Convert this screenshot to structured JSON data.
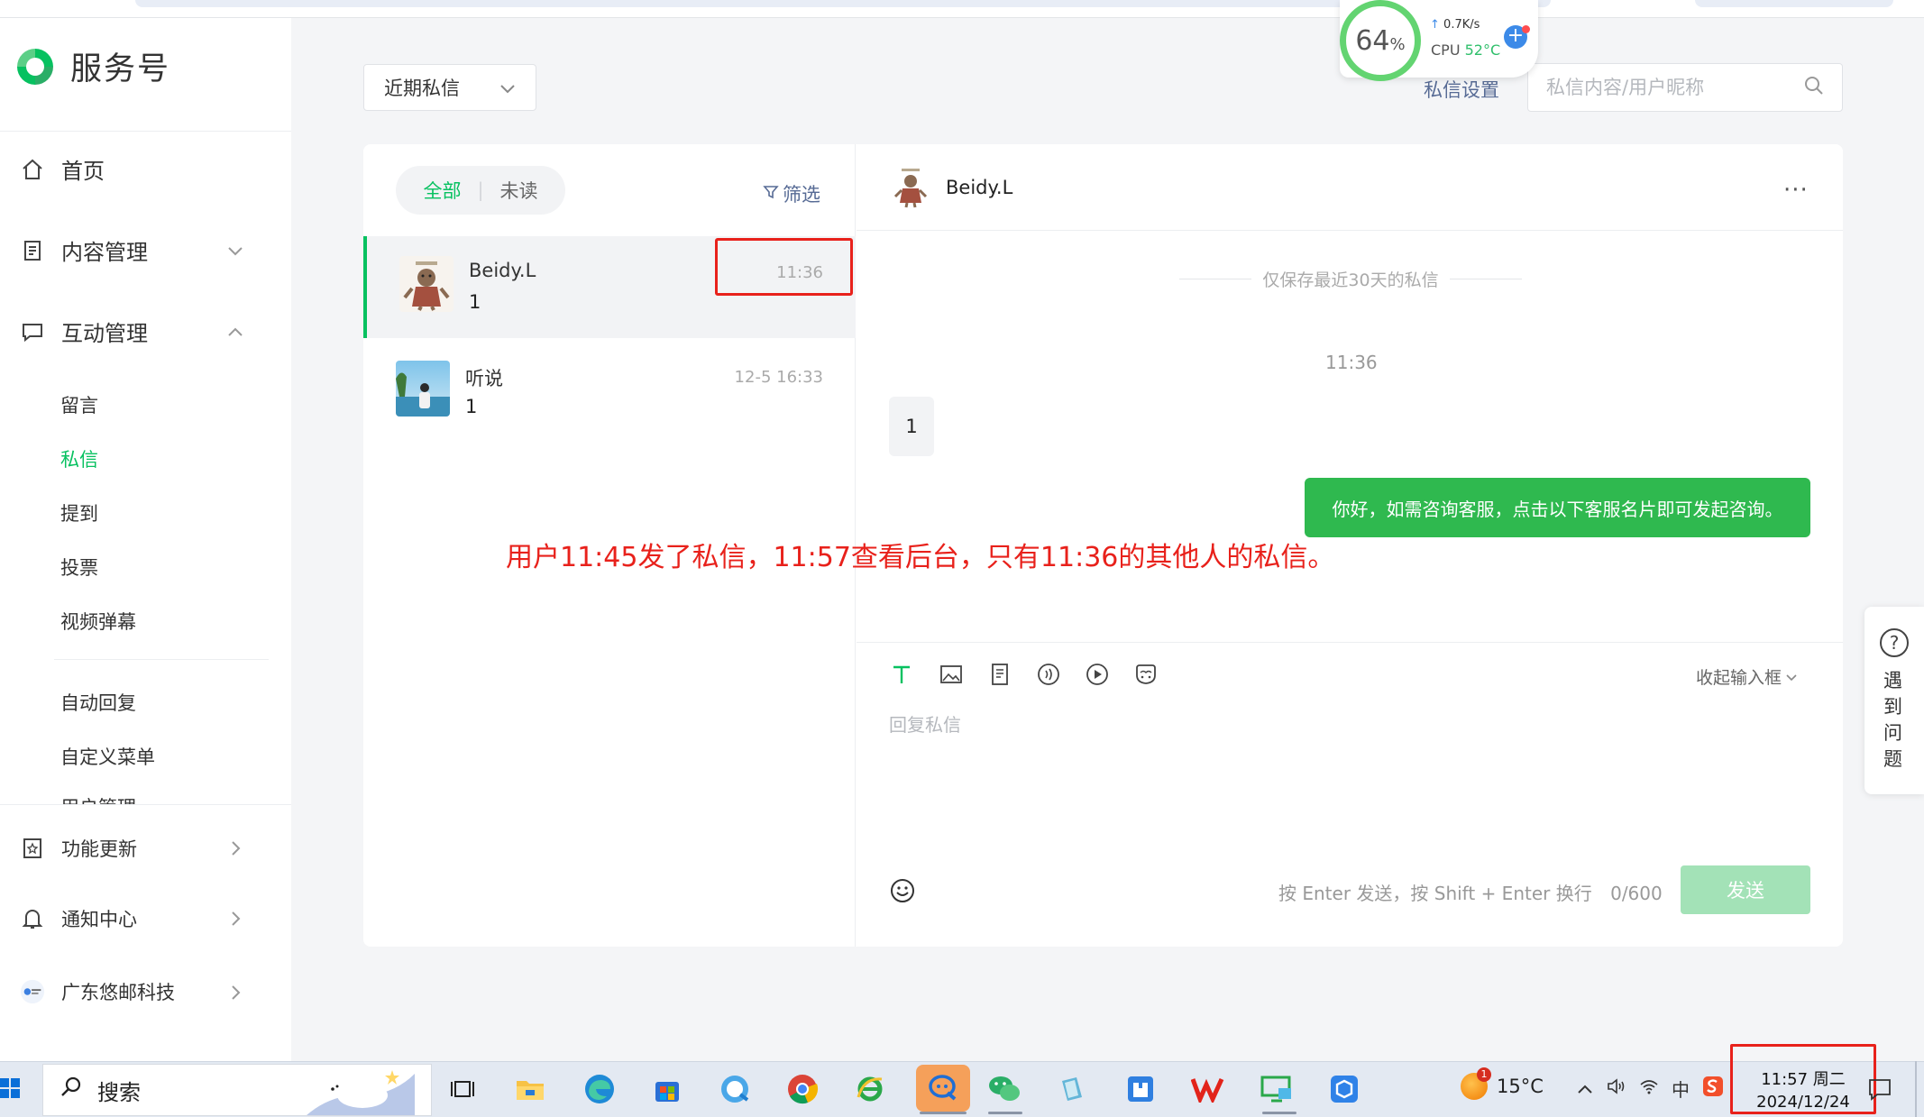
{
  "colors": {
    "accent_green": "#07c160",
    "link_blue": "#576b95",
    "annotation_red": "#e8211b",
    "send_disabled": "#a3e2b7",
    "bubble_out": "#2fb94f"
  },
  "brand": {
    "name": "服务号",
    "icon": "wechat-service-logo-icon"
  },
  "sidebar": {
    "items": [
      {
        "label": "首页",
        "icon": "home-icon"
      },
      {
        "label": "内容管理",
        "icon": "document-icon",
        "arrow": "chevron-down-icon"
      },
      {
        "label": "互动管理",
        "icon": "chat-bubble-icon",
        "arrow": "chevron-up-icon"
      },
      {
        "label": "功能更新",
        "icon": "star-badge-icon",
        "arrow": "chevron-right-icon"
      },
      {
        "label": "通知中心",
        "icon": "bell-icon",
        "arrow": "chevron-right-icon"
      },
      {
        "label": "广东悠邮科技",
        "icon": "account-avatar-icon",
        "arrow": "chevron-right-icon"
      }
    ],
    "interaction_sub": [
      "留言",
      "私信",
      "提到",
      "投票",
      "视频弹幕"
    ],
    "interaction_sub_active": "私信",
    "more_sub": [
      "自动回复",
      "自定义菜单",
      "用户管理"
    ]
  },
  "header": {
    "filter_select": "近期私信",
    "settings_link": "私信设置",
    "search_placeholder": "私信内容/用户昵称"
  },
  "monitor": {
    "percent": "64",
    "percent_unit": "%",
    "speed": "0.7K/s",
    "cpu_label": "CPU",
    "cpu_temp": "52°C"
  },
  "list": {
    "tab_all": "全部",
    "tab_unread": "未读",
    "filter_label": "筛选",
    "conversations": [
      {
        "name": "Beidy.L",
        "preview": "1",
        "time": "11:36",
        "selected": true
      },
      {
        "name": "听说",
        "preview": "1",
        "time": "12-5 16:33",
        "selected": false
      }
    ]
  },
  "chat": {
    "title": "Beidy.L",
    "more": "···",
    "notice": "仅保存最近30天的私信",
    "time": "11:36",
    "incoming": "1",
    "outgoing": "你好，如需咨询客服，点击以下客服名片即可发起咨询。",
    "tools": [
      "text-icon",
      "image-icon",
      "article-icon",
      "audio-icon",
      "video-icon",
      "card-icon"
    ],
    "collapse_label": "收起输入框",
    "reply_placeholder": "回复私信",
    "send_hint": "按 Enter 发送，按 Shift + Enter 换行",
    "char_count": "0/600",
    "send_label": "发送"
  },
  "annotation": {
    "text": "用户11:45发了私信，11:57查看后台，只有11:36的其他人的私信。"
  },
  "help": {
    "label": "遇到问题"
  },
  "taskbar": {
    "search_label": "搜索",
    "weather_temp": "15°C",
    "weather_badge": "1",
    "ime": "中",
    "clock_time": "11:57 周二",
    "clock_date": "2024/12/24",
    "apps": [
      "task-view-icon",
      "file-explorer-icon",
      "edge-icon",
      "store-icon",
      "qq-browser-icon",
      "chrome-icon",
      "ie-icon",
      "feishu-icon",
      "wechat-icon",
      "notepad-icon",
      "calendar-app-icon",
      "wps-icon",
      "remote-desktop-icon",
      "cube-app-icon"
    ]
  }
}
